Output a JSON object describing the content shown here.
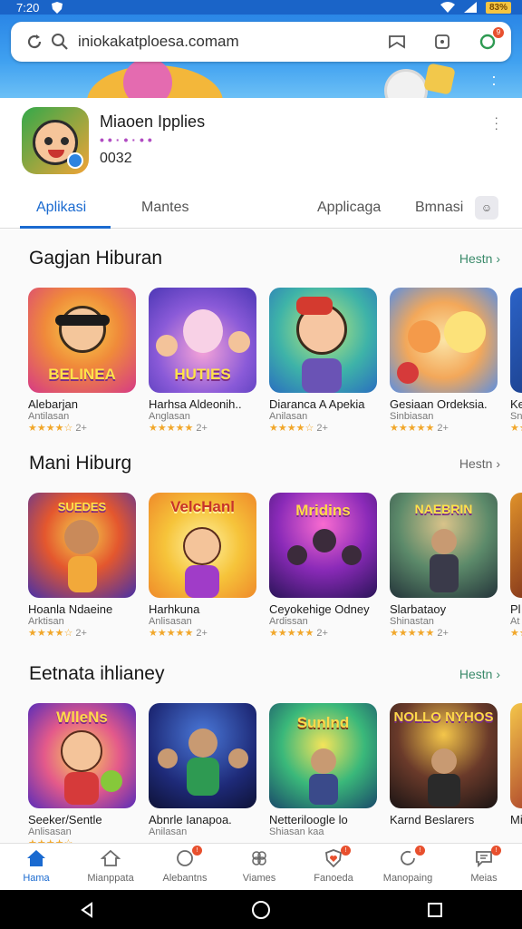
{
  "status_bar": {
    "time": "7:20",
    "battery": "83%"
  },
  "browser": {
    "url": "iniokakatploesa.comam",
    "badge": "9"
  },
  "app_header": {
    "title": "Miaoen Ipplies",
    "subtitle": "••·•·••",
    "count": "0032"
  },
  "tabs": [
    {
      "label": "Aplikasi"
    },
    {
      "label": "Mantes"
    },
    {
      "label": "Applicaga"
    },
    {
      "label": "Bmnasi"
    }
  ],
  "sections": [
    {
      "title": "Gagjan Hiburan",
      "link": "Hestn",
      "items": [
        {
          "title": "Alebarjan",
          "subtitle": "Antilasan",
          "stars": "★★★★☆",
          "rating_extra": "2+",
          "thumb_text": "BELINEA"
        },
        {
          "title": "Harhsa Aldeonih..",
          "subtitle": "Anglasan",
          "stars": "★★★★★",
          "rating_extra": "2+",
          "thumb_text": "HUTIES"
        },
        {
          "title": "Diaranca A Apekia",
          "subtitle": "Anilasan",
          "stars": "★★★★☆",
          "rating_extra": "2+",
          "thumb_text": ""
        },
        {
          "title": "Gesiaan Ordeksia.",
          "subtitle": "Sinbiasan",
          "stars": "★★★★★",
          "rating_extra": "2+",
          "thumb_text": ""
        },
        {
          "title": "Ke",
          "subtitle": "Sn",
          "stars": "★★",
          "rating_extra": "",
          "thumb_text": ""
        }
      ]
    },
    {
      "title": "Mani Hiburg",
      "link": "Hestn",
      "items": [
        {
          "title": "Hoanla Ndaeine",
          "subtitle": "Arktisan",
          "stars": "★★★★☆",
          "rating_extra": "2+",
          "thumb_text": "SUEDES"
        },
        {
          "title": "Harhkuna",
          "subtitle": "Anlisasan",
          "stars": "★★★★★",
          "rating_extra": "2+",
          "thumb_text": "VelcHanl"
        },
        {
          "title": "Ceyokehige Odney",
          "subtitle": "Ardissan",
          "stars": "★★★★★",
          "rating_extra": "2+",
          "thumb_text": "Mridins"
        },
        {
          "title": "Slarbataoy",
          "subtitle": "Shinastan",
          "stars": "★★★★★",
          "rating_extra": "2+",
          "thumb_text": "NAEBRIN"
        },
        {
          "title": "Pl",
          "subtitle": "At",
          "stars": "★★",
          "rating_extra": "",
          "thumb_text": ""
        }
      ]
    },
    {
      "title": "Eetnata ihlianey",
      "link": "Hestn",
      "items": [
        {
          "title": "Seeker/Sentle",
          "subtitle": "Anlisasan",
          "stars": "★★★★☆",
          "rating_extra": "",
          "thumb_text": "WlleNs"
        },
        {
          "title": "Abnrle Ianapoa.",
          "subtitle": "Anilasan",
          "stars": "",
          "rating_extra": "",
          "thumb_text": ""
        },
        {
          "title": "Netteriloogle lo",
          "subtitle": "Shiasan kaa",
          "stars": "",
          "rating_extra": "",
          "thumb_text": "Sunlnd"
        },
        {
          "title": "Karnd Beslarers",
          "subtitle": "",
          "stars": "",
          "rating_extra": "",
          "thumb_text": "NOLLO NYHOS"
        },
        {
          "title": "Mi",
          "subtitle": "",
          "stars": "",
          "rating_extra": "",
          "thumb_text": ""
        }
      ]
    }
  ],
  "bottom_nav": [
    {
      "label": "Hama",
      "icon": "home-icon"
    },
    {
      "label": "Mianppata",
      "icon": "store-icon"
    },
    {
      "label": "Alebantns",
      "icon": "games-icon"
    },
    {
      "label": "Viames",
      "icon": "apps-icon"
    },
    {
      "label": "Fanoeda",
      "icon": "heart-shield-icon"
    },
    {
      "label": "Manopaing",
      "icon": "refresh-icon"
    },
    {
      "label": "Meias",
      "icon": "chat-icon"
    }
  ],
  "colors": {
    "accent": "#1a6ad0",
    "status_bar": "#1a64c8",
    "badge": "#e8502e",
    "star": "#f1a72b"
  }
}
